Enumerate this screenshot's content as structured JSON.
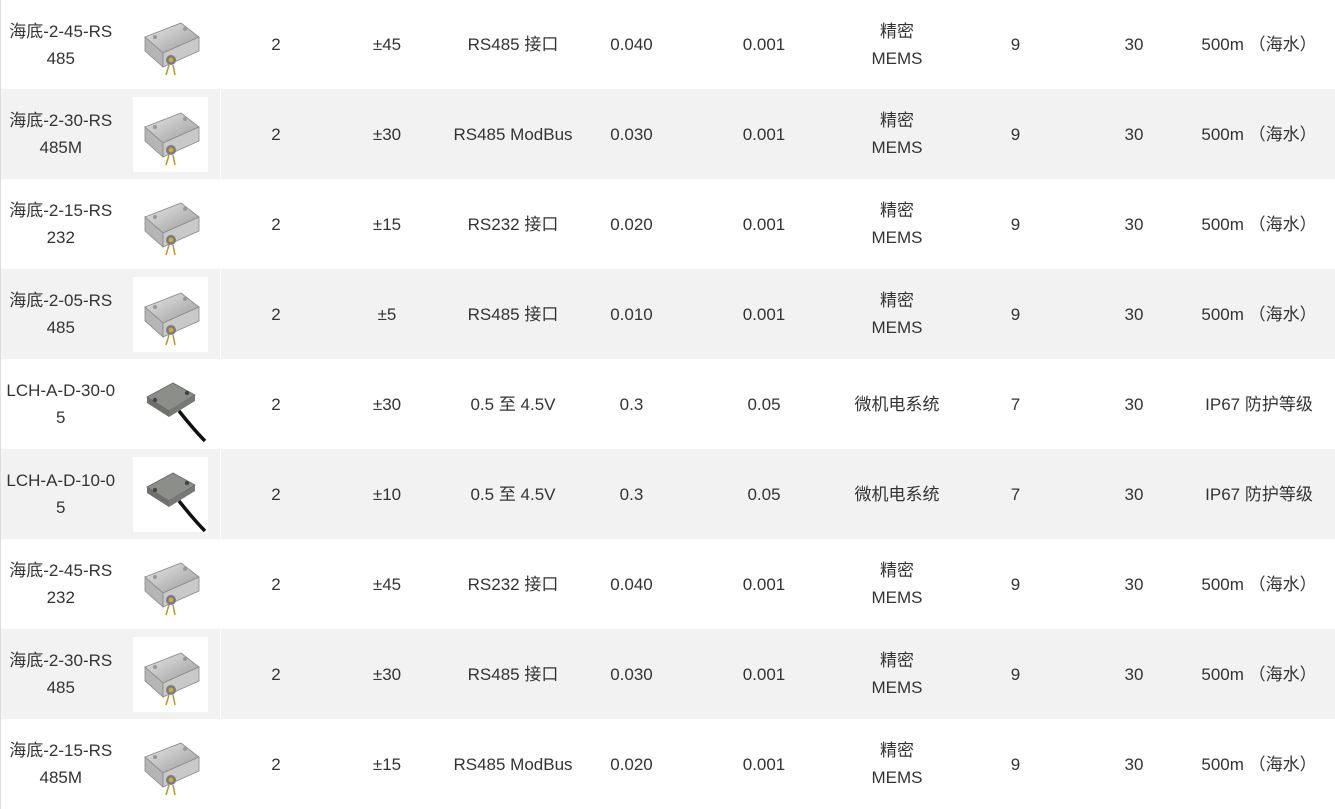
{
  "table": {
    "rows": [
      {
        "model": "海底-2-45-RS485",
        "image": "mems-sensor-box-icon",
        "axes": "2",
        "range": "±45",
        "output": "RS485 接口",
        "accuracy": "0.040",
        "resolution": "0.001",
        "tech": "精密 MEMS",
        "voltage": "9",
        "bandwidth": "30",
        "protection": "500m （海水）"
      },
      {
        "model": "海底-2-30-RS485M",
        "image": "mems-sensor-box-icon",
        "axes": "2",
        "range": "±30",
        "output": "RS485 ModBus",
        "accuracy": "0.030",
        "resolution": "0.001",
        "tech": "精密 MEMS",
        "voltage": "9",
        "bandwidth": "30",
        "protection": "500m （海水）"
      },
      {
        "model": "海底-2-15-RS232",
        "image": "mems-sensor-box-icon",
        "axes": "2",
        "range": "±15",
        "output": "RS232 接口",
        "accuracy": "0.020",
        "resolution": "0.001",
        "tech": "精密 MEMS",
        "voltage": "9",
        "bandwidth": "30",
        "protection": "500m （海水）"
      },
      {
        "model": "海底-2-05-RS485",
        "image": "mems-sensor-box-icon",
        "axes": "2",
        "range": "±5",
        "output": "RS485 接口",
        "accuracy": "0.010",
        "resolution": "0.001",
        "tech": "精密 MEMS",
        "voltage": "9",
        "bandwidth": "30",
        "protection": "500m （海水）"
      },
      {
        "model": "LCH-A-D-30-05",
        "image": "cable-sensor-icon",
        "axes": "2",
        "range": "±30",
        "output": "0.5 至 4.5V",
        "accuracy": "0.3",
        "resolution": "0.05",
        "tech": "微机电系统",
        "voltage": "7",
        "bandwidth": "30",
        "protection": "IP67 防护等级"
      },
      {
        "model": "LCH-A-D-10-05",
        "image": "cable-sensor-icon",
        "axes": "2",
        "range": "±10",
        "output": "0.5 至 4.5V",
        "accuracy": "0.3",
        "resolution": "0.05",
        "tech": "微机电系统",
        "voltage": "7",
        "bandwidth": "30",
        "protection": "IP67 防护等级"
      },
      {
        "model": "海底-2-45-RS232",
        "image": "mems-sensor-box-icon",
        "axes": "2",
        "range": "±45",
        "output": "RS232 接口",
        "accuracy": "0.040",
        "resolution": "0.001",
        "tech": "精密 MEMS",
        "voltage": "9",
        "bandwidth": "30",
        "protection": "500m （海水）"
      },
      {
        "model": "海底-2-30-RS485",
        "image": "mems-sensor-box-icon",
        "axes": "2",
        "range": "±30",
        "output": "RS485 接口",
        "accuracy": "0.030",
        "resolution": "0.001",
        "tech": "精密 MEMS",
        "voltage": "9",
        "bandwidth": "30",
        "protection": "500m （海水）"
      },
      {
        "model": "海底-2-15-RS485M",
        "image": "mems-sensor-box-icon",
        "axes": "2",
        "range": "±15",
        "output": "RS485 ModBus",
        "accuracy": "0.020",
        "resolution": "0.001",
        "tech": "精密 MEMS",
        "voltage": "9",
        "bandwidth": "30",
        "protection": "500m （海水）"
      }
    ]
  },
  "colors": {
    "row_alt": "#f2f2f2",
    "row": "#ffffff",
    "text": "#333333"
  }
}
